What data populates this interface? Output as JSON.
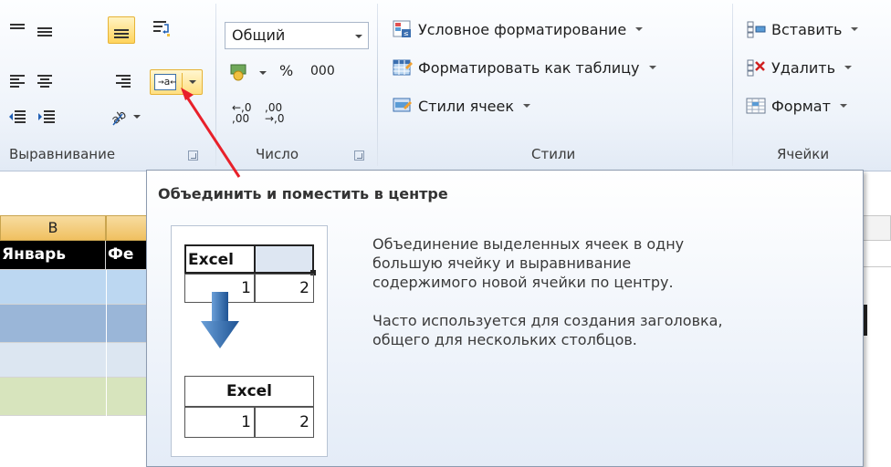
{
  "ribbon": {
    "alignment": {
      "label": "Выравнивание",
      "icons": [
        "align-top-icon",
        "align-middle-icon",
        "align-bottom-icon",
        "wrap-text-icon",
        "align-left-icon",
        "align-center-icon",
        "align-right-icon",
        "merge-center-icon",
        "decrease-indent-icon",
        "increase-indent-icon",
        "text-orientation-icon"
      ]
    },
    "number": {
      "label": "Число",
      "format_value": "Общий",
      "percent_label": "%",
      "thousands_label": "000",
      "increase_decimal_label": "←,0\n,00",
      "decrease_decimal_label": ",00\n→,0"
    },
    "styles": {
      "label": "Стили",
      "conditional": "Условное форматирование",
      "format_table": "Форматировать как таблицу",
      "cell_styles": "Стили ячеек"
    },
    "cells": {
      "label": "Ячейки",
      "insert": "Вставить",
      "delete": "Удалить",
      "format": "Формат"
    }
  },
  "sheet": {
    "col_b": "B",
    "header_b": "Январь",
    "header_c": "Фе",
    "row_colors": [
      "#bcd7f1",
      "#9ab6d8",
      "#dce6f1",
      "#d7e4bd"
    ]
  },
  "tooltip": {
    "title": "Объединить и поместить в центре",
    "desc_1": "Объединение выделенных ячеек в одну\nбольшую ячейку и выравнивание\nсодержимого новой ячейки по центру.",
    "desc_2": "Часто используется для создания заголовка,\nобщего для нескольких столбцов.",
    "preview": {
      "before_text": "Excel",
      "after_text": "Excel",
      "num_1": "1",
      "num_2": "2"
    }
  },
  "colors": {
    "accent_red": "#e8202a",
    "highlight": "#ffd45c"
  }
}
